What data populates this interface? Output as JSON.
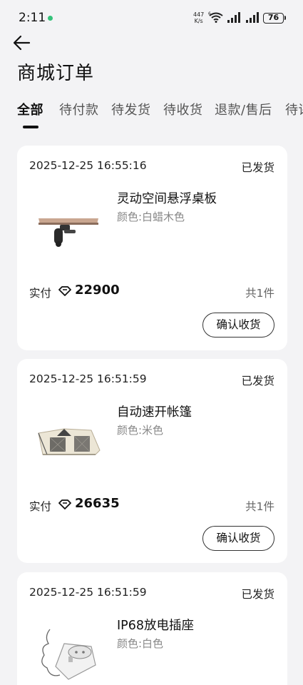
{
  "status_bar": {
    "time": "2:11",
    "net_speed": "447",
    "net_unit": "K/s",
    "wifi_badge": "6",
    "battery": "76"
  },
  "page": {
    "title": "商城订单"
  },
  "tabs": [
    {
      "label": "全部"
    },
    {
      "label": "待付款"
    },
    {
      "label": "待发货"
    },
    {
      "label": "待收货"
    },
    {
      "label": "退款/售后"
    },
    {
      "label": "待评"
    }
  ],
  "orders": [
    {
      "time": "2025-12-25 16:55:16",
      "status": "已发货",
      "product_name": "灵动空间悬浮桌板",
      "spec": "颜色:白蜡木色",
      "paid_label": "实付",
      "amount": "22900",
      "count": "共1件",
      "action": "确认收货"
    },
    {
      "time": "2025-12-25 16:51:59",
      "status": "已发货",
      "product_name": "自动速开帐篷",
      "spec": "颜色:米色",
      "paid_label": "实付",
      "amount": "26635",
      "count": "共1件",
      "action": "确认收货"
    },
    {
      "time": "2025-12-25 16:51:59",
      "status": "已发货",
      "product_name": "IP68放电插座",
      "spec": "颜色:白色"
    }
  ],
  "colors": {
    "background": "#f3f3f5",
    "card": "#ffffff",
    "text_primary": "#111111",
    "text_secondary": "#888888",
    "status_dot": "#35c27a"
  }
}
